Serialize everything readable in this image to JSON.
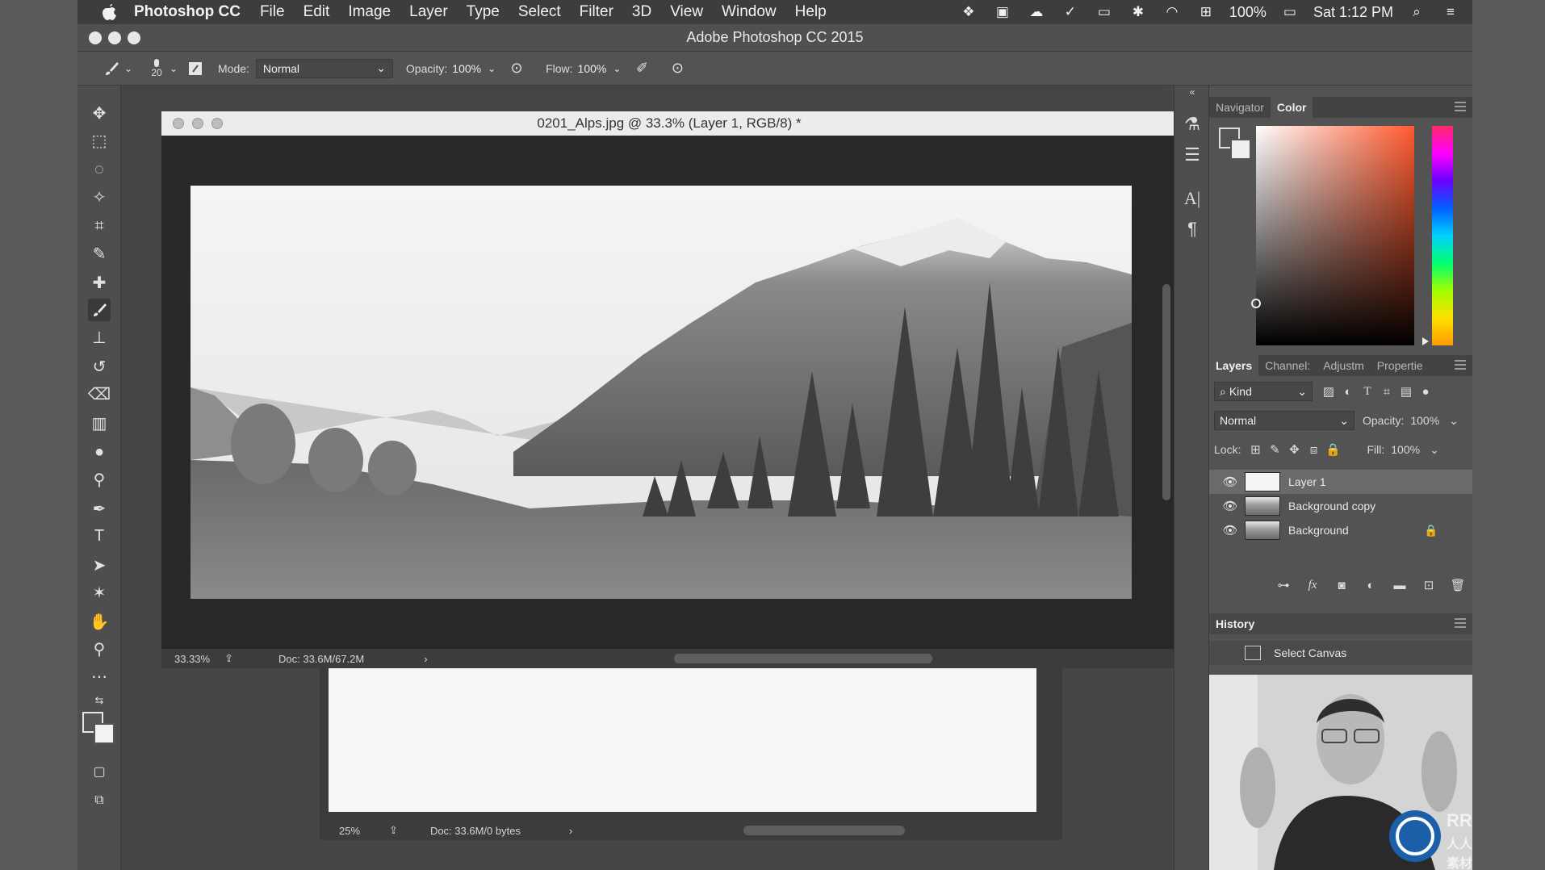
{
  "menubar": {
    "app_name": "Photoshop CC",
    "items": [
      "File",
      "Edit",
      "Image",
      "Layer",
      "Type",
      "Select",
      "Filter",
      "3D",
      "View",
      "Window",
      "Help"
    ],
    "battery": "100%",
    "clock": "Sat 1:12 PM"
  },
  "window": {
    "title": "Adobe Photoshop CC 2015"
  },
  "options_bar": {
    "brush_size": "20",
    "mode_label": "Mode:",
    "mode_value": "Normal",
    "opacity_label": "Opacity:",
    "opacity_value": "100%",
    "flow_label": "Flow:",
    "flow_value": "100%"
  },
  "document": {
    "tab_title": "0201_Alps.jpg @ 33.3% (Layer 1, RGB/8) *",
    "zoom": "33.33%",
    "doc_size": "Doc: 33.6M/67.2M"
  },
  "document2": {
    "zoom": "25%",
    "doc_size": "Doc: 33.6M/0 bytes"
  },
  "color_panel": {
    "tabs": [
      "Navigator",
      "Color"
    ],
    "active_tab": "Color"
  },
  "layers_panel": {
    "tabs": [
      "Layers",
      "Channel:",
      "Adjustm",
      "Propertie"
    ],
    "filter_kind": "Kind",
    "blend_mode": "Normal",
    "opacity_label": "Opacity:",
    "opacity_value": "100%",
    "lock_label": "Lock:",
    "fill_label": "Fill:",
    "fill_value": "100%",
    "layers": [
      {
        "name": "Layer 1",
        "selected": true,
        "locked": false
      },
      {
        "name": "Background copy",
        "selected": false,
        "locked": false
      },
      {
        "name": "Background",
        "selected": false,
        "locked": true
      }
    ],
    "footer_fx": "fx"
  },
  "history_panel": {
    "title": "History",
    "items": [
      "Select Canvas"
    ]
  },
  "watermark": {
    "brand": "RRCG",
    "cn": "人人素材"
  }
}
